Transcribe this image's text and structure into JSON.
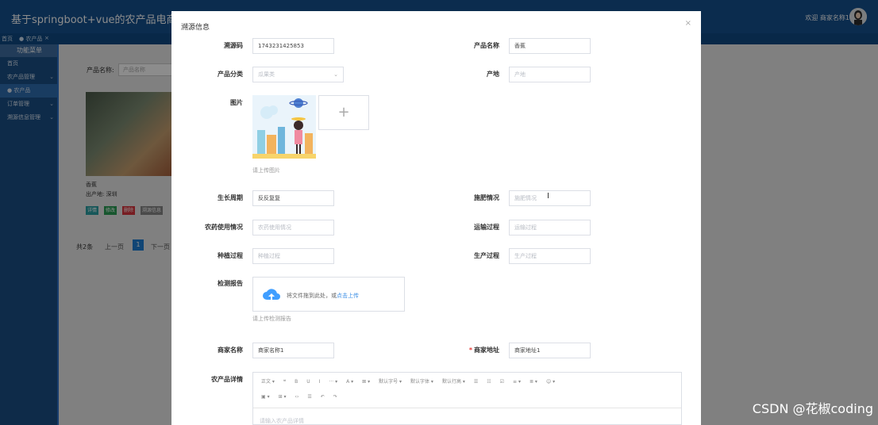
{
  "header": {
    "title": "基于springboot+vue的农产品电商系统设计",
    "welcome": "欢迎 商家名称1"
  },
  "tabs": [
    "首页",
    "● 农产品",
    "×"
  ],
  "sidebar": {
    "title": "功能菜单",
    "items": [
      {
        "label": "首页",
        "chevron": ""
      },
      {
        "label": "农产品管理",
        "chevron": "⌄"
      },
      {
        "label": "● 农产品",
        "chevron": ""
      },
      {
        "label": "订单管理",
        "chevron": "⌄"
      },
      {
        "label": "溯源信息管理",
        "chevron": "⌄"
      }
    ]
  },
  "background": {
    "search_label": "产品名称:",
    "search_placeholder": "产品名称",
    "card_name": "香蕉",
    "card_origin": "出产地: 深圳",
    "buttons": [
      {
        "label": "详情",
        "color": "#2a9ea3"
      },
      {
        "label": "修改",
        "color": "#2a9d55"
      },
      {
        "label": "删除",
        "color": "#d9363e"
      },
      {
        "label": "溯源信息",
        "color": "#888888"
      }
    ],
    "pager_total": "共2条",
    "pager_prev": "上一页",
    "pager_page": "1",
    "pager_next": "下一页"
  },
  "dialog": {
    "title": "溯源信息",
    "close": "×",
    "fields": {
      "trace_code": {
        "label": "溯源码",
        "value": "1743231425853"
      },
      "product_name": {
        "label": "产品名称",
        "value": "香蕉"
      },
      "category": {
        "label": "产品分类",
        "value": "瓜果类"
      },
      "origin": {
        "label": "产地",
        "placeholder": "产地"
      },
      "image": {
        "label": "图片",
        "hint": "请上传图片"
      },
      "growth_cycle": {
        "label": "生长周期",
        "value": "反反复复"
      },
      "fertilize": {
        "label": "施肥情况",
        "placeholder": "施肥情况"
      },
      "pesticide": {
        "label": "农药使用情况",
        "placeholder": "农药使用情况"
      },
      "transport": {
        "label": "运输过程",
        "placeholder": "运输过程"
      },
      "planting": {
        "label": "种植过程",
        "placeholder": "种植过程"
      },
      "production": {
        "label": "生产过程",
        "placeholder": "生产过程"
      },
      "report": {
        "label": "检测报告",
        "drop_text": "将文件拖到此处，或",
        "drop_link": "点击上传",
        "hint": "请上传检测报告"
      },
      "merchant_name": {
        "label": "商家名称",
        "value": "商家名称1"
      },
      "merchant_address": {
        "label": "商家地址",
        "required": "*",
        "value": "商家地址1"
      },
      "details": {
        "label": "农产品详情",
        "toolbar_row1": [
          "正文 ▾",
          "❝",
          "B",
          "U",
          "I",
          "··· ▾",
          "A ▾",
          "⊠ ▾",
          "默认字号 ▾",
          "默认字体 ▾",
          "默认行高 ▾",
          "☰",
          "☷",
          "☑",
          "≡ ▾",
          "≣ ▾",
          "☺ ▾"
        ],
        "toolbar_row2": [
          "▣ ▾",
          "⊞ ▾",
          "‹›",
          "☰",
          "↶",
          "↷"
        ],
        "placeholder": "请输入农产品详情"
      }
    }
  },
  "watermark": "CSDN @花椒coding"
}
